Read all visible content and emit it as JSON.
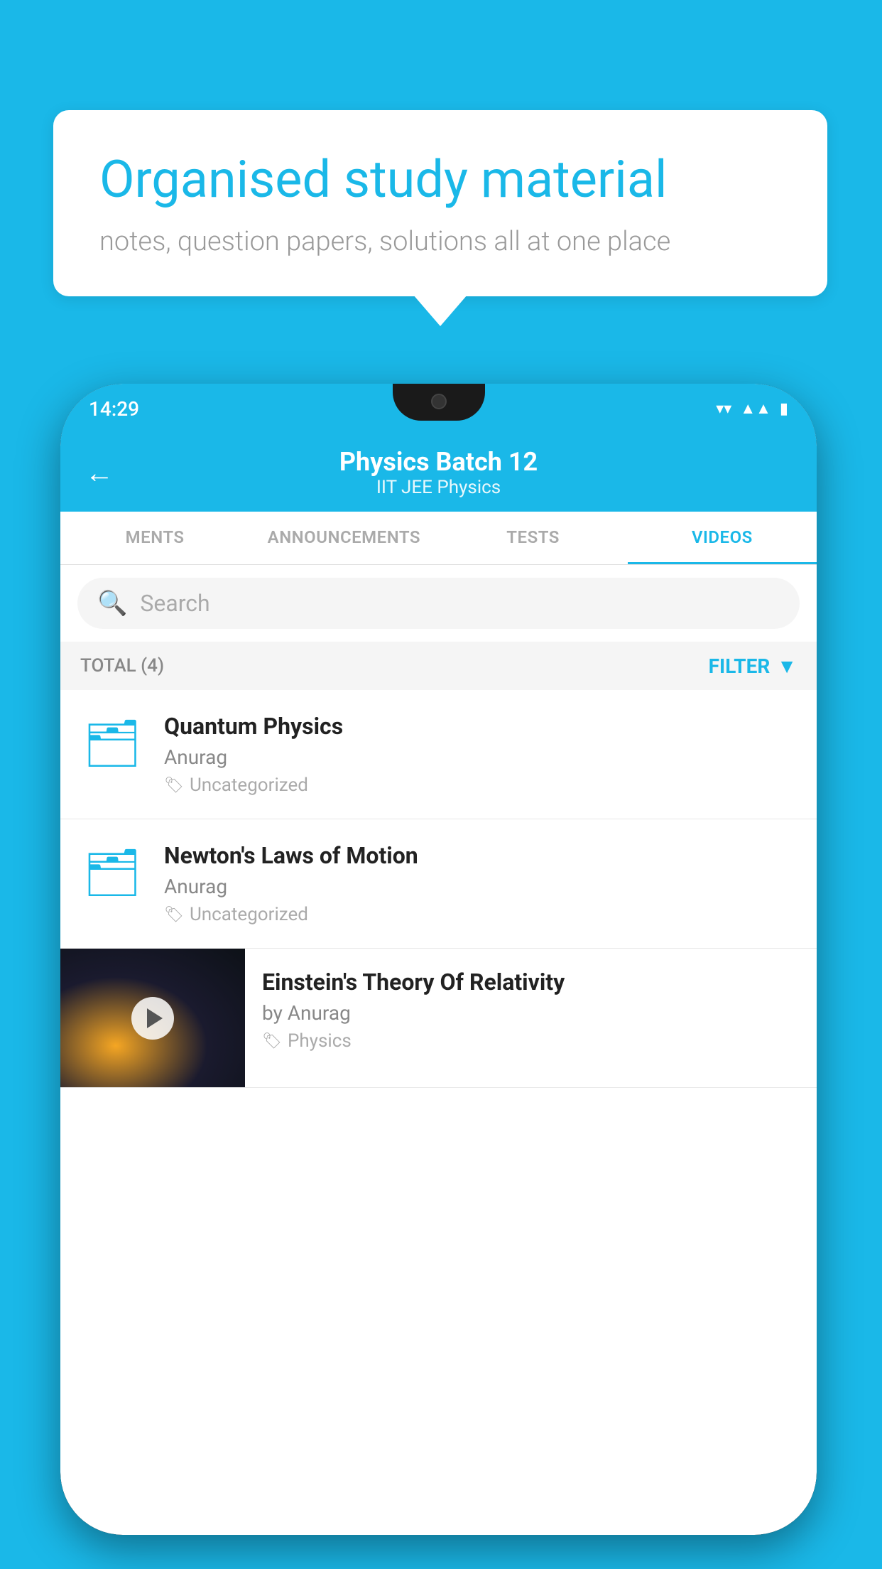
{
  "background": {
    "color": "#1ab8e8"
  },
  "speech_bubble": {
    "title": "Organised study material",
    "subtitle": "notes, question papers, solutions all at one place"
  },
  "phone": {
    "status_bar": {
      "time": "14:29",
      "icons": [
        "wifi",
        "signal",
        "battery"
      ]
    },
    "header": {
      "back_label": "←",
      "title": "Physics Batch 12",
      "subtitle": "IIT JEE   Physics"
    },
    "tabs": [
      {
        "label": "MENTS",
        "active": false
      },
      {
        "label": "ANNOUNCEMENTS",
        "active": false
      },
      {
        "label": "TESTS",
        "active": false
      },
      {
        "label": "VIDEOS",
        "active": true
      }
    ],
    "search": {
      "placeholder": "Search"
    },
    "filter_bar": {
      "total_label": "TOTAL (4)",
      "filter_label": "FILTER"
    },
    "video_items": [
      {
        "id": 1,
        "title": "Quantum Physics",
        "author": "Anurag",
        "tag": "Uncategorized",
        "has_thumbnail": false
      },
      {
        "id": 2,
        "title": "Newton's Laws of Motion",
        "author": "Anurag",
        "tag": "Uncategorized",
        "has_thumbnail": false
      },
      {
        "id": 3,
        "title": "Einstein's Theory Of Relativity",
        "author": "by Anurag",
        "tag": "Physics",
        "has_thumbnail": true
      }
    ]
  }
}
